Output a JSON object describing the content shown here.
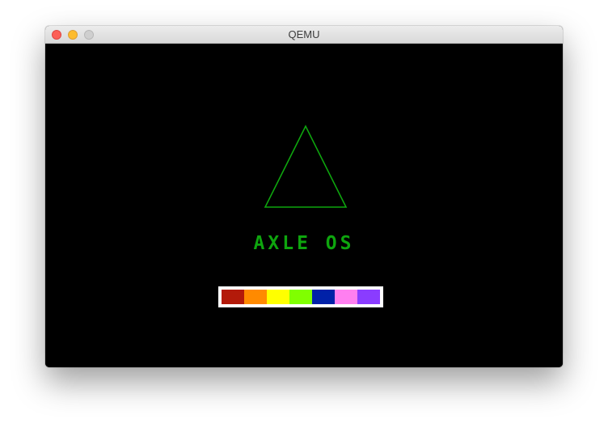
{
  "window": {
    "title": "QEMU",
    "controls": [
      "close",
      "minimize",
      "zoom"
    ]
  },
  "screen": {
    "background": "#000000",
    "logo": {
      "shape": "triangle-outline",
      "color": "#0ea50e"
    },
    "os_name": "AXLE OS",
    "text_color": "#0ea50e",
    "palette": {
      "border_color": "#ffffff",
      "colors": [
        "#b31a0a",
        "#ff8a00",
        "#ffff00",
        "#80ff00",
        "#0021a8",
        "#ff7ff0",
        "#8a3cff"
      ]
    }
  }
}
